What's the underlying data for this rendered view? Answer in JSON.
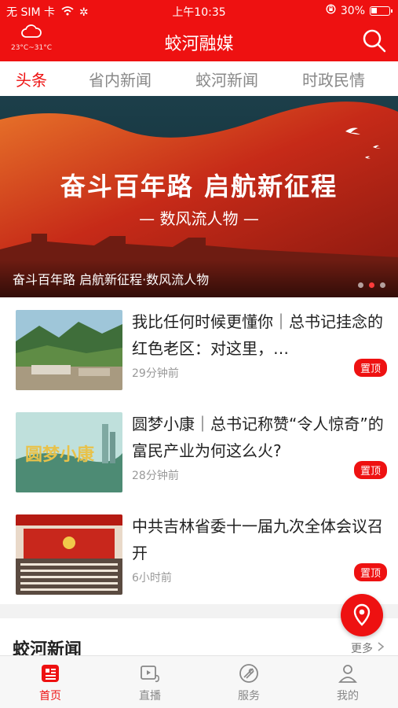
{
  "status_bar": {
    "carrier": "无 SIM 卡",
    "time": "上午10:35",
    "battery": "30%"
  },
  "header": {
    "title": "蛟河融媒",
    "weather_temp": "23°C~31°C",
    "weather_icon": "cloud-icon",
    "search_icon": "search-icon"
  },
  "tabs": [
    {
      "label": "头条"
    },
    {
      "label": "省内新闻"
    },
    {
      "label": "蛟河新闻"
    },
    {
      "label": "时政民情"
    }
  ],
  "banner": {
    "title": "奋斗百年路 启航新征程",
    "subtitle": "— 数风流人物 —",
    "caption": "奋斗百年路 启航新征程·数风流人物",
    "slide_count": 3,
    "active_slide": 2
  },
  "news": [
    {
      "title": "我比任何时候更懂你｜总书记挂念的红色老区：对这里，…",
      "time": "29分钟前",
      "badge": "置顶"
    },
    {
      "title": "圆梦小康｜总书记称赞“令人惊奇”的富民产业为何这么火?",
      "time": "28分钟前",
      "badge": "置顶",
      "thumb_text": "圆梦小康"
    },
    {
      "title": "中共吉林省委十一届九次全体会议召开",
      "time": "6小时前",
      "badge": "置顶"
    }
  ],
  "section": {
    "title": "蛟河新闻",
    "more": "更多"
  },
  "tabbar": [
    {
      "label": "首页",
      "icon": "home-news-icon"
    },
    {
      "label": "直播",
      "icon": "live-video-icon"
    },
    {
      "label": "服务",
      "icon": "service-icon"
    },
    {
      "label": "我的",
      "icon": "profile-icon"
    }
  ],
  "colors": {
    "brand_red": "#ee1111",
    "text_primary": "#222222",
    "text_secondary": "#999999"
  }
}
